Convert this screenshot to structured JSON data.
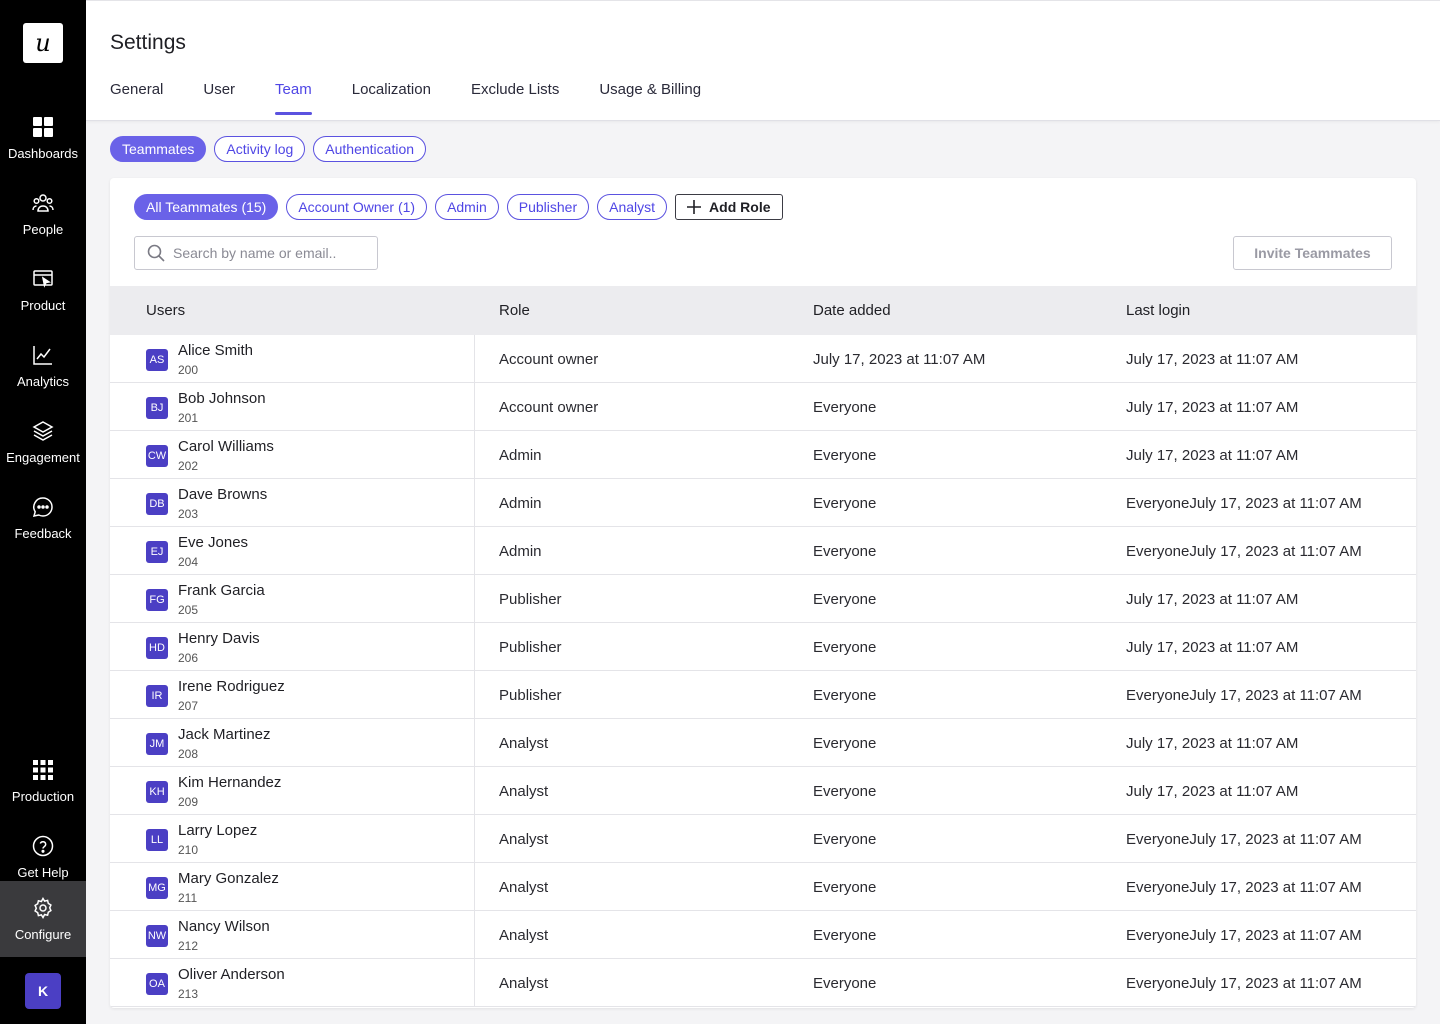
{
  "sidebar": {
    "logo": "u",
    "items": [
      {
        "label": "Dashboards",
        "icon": "dashboard-grid-icon"
      },
      {
        "label": "People",
        "icon": "people-icon"
      },
      {
        "label": "Product",
        "icon": "product-icon"
      },
      {
        "label": "Analytics",
        "icon": "analytics-chart-icon"
      },
      {
        "label": "Engagement",
        "icon": "layers-icon"
      },
      {
        "label": "Feedback",
        "icon": "chat-bubble-icon"
      }
    ],
    "bottom_items": [
      {
        "label": "Production",
        "icon": "apps-grid-icon"
      },
      {
        "label": "Get Help",
        "icon": "help-circle-icon"
      },
      {
        "label": "Configure",
        "icon": "gear-icon"
      }
    ],
    "user_avatar": "K"
  },
  "header": {
    "title": "Settings",
    "tabs": [
      "General",
      "User",
      "Team",
      "Localization",
      "Exclude Lists",
      "Usage & Billing"
    ],
    "active_tab": "Team"
  },
  "subtabs": [
    "Teammates",
    "Activity log",
    "Authentication"
  ],
  "roles": {
    "filters": [
      "All Teammates (15)",
      "Account Owner (1)",
      "Admin",
      "Publisher",
      "Analyst"
    ],
    "add_label": "Add Role"
  },
  "search": {
    "placeholder": "Search by name or email.."
  },
  "invite_label": "Invite Teammates",
  "table": {
    "headers": [
      "Users",
      "Role",
      "Date added",
      "Last login"
    ],
    "rows": [
      {
        "initials": "AS",
        "name": "Alice Smith",
        "id": "200",
        "role": "Account owner",
        "date": "July 17, 2023 at 11:07 AM",
        "login": "July 17, 2023 at 11:07 AM"
      },
      {
        "initials": "BJ",
        "name": "Bob Johnson",
        "id": "201",
        "role": "Account owner",
        "date": "Everyone",
        "login": "July 17, 2023 at 11:07 AM"
      },
      {
        "initials": "CW",
        "name": "Carol Williams",
        "id": "202",
        "role": "Admin",
        "date": "Everyone",
        "login": "July 17, 2023 at 11:07 AM"
      },
      {
        "initials": "DB",
        "name": "Dave Browns",
        "id": "203",
        "role": "Admin",
        "date": "Everyone",
        "login": "EveryoneJuly 17, 2023 at 11:07 AM"
      },
      {
        "initials": "EJ",
        "name": "Eve Jones",
        "id": "204",
        "role": "Admin",
        "date": "Everyone",
        "login": "EveryoneJuly 17, 2023 at 11:07 AM"
      },
      {
        "initials": "FG",
        "name": "Frank Garcia",
        "id": "205",
        "role": "Publisher",
        "date": "Everyone",
        "login": "July 17, 2023 at 11:07 AM"
      },
      {
        "initials": "HD",
        "name": "Henry Davis",
        "id": "206",
        "role": "Publisher",
        "date": "Everyone",
        "login": "July 17, 2023 at 11:07 AM"
      },
      {
        "initials": "IR",
        "name": "Irene Rodriguez",
        "id": "207",
        "role": "Publisher",
        "date": "Everyone",
        "login": "EveryoneJuly 17, 2023 at 11:07 AM"
      },
      {
        "initials": "JM",
        "name": "Jack Martinez",
        "id": "208",
        "role": "Analyst",
        "date": "Everyone",
        "login": "July 17, 2023 at 11:07 AM"
      },
      {
        "initials": "KH",
        "name": "Kim Hernandez",
        "id": "209",
        "role": "Analyst",
        "date": "Everyone",
        "login": "July 17, 2023 at 11:07 AM"
      },
      {
        "initials": "LL",
        "name": "Larry Lopez",
        "id": "210",
        "role": "Analyst",
        "date": "Everyone",
        "login": "EveryoneJuly 17, 2023 at 11:07 AM"
      },
      {
        "initials": "MG",
        "name": "Mary Gonzalez",
        "id": "211",
        "role": "Analyst",
        "date": "Everyone",
        "login": "EveryoneJuly 17, 2023 at 11:07 AM"
      },
      {
        "initials": "NW",
        "name": "Nancy Wilson",
        "id": "212",
        "role": "Analyst",
        "date": "Everyone",
        "login": "EveryoneJuly 17, 2023 at 11:07 AM"
      },
      {
        "initials": "OA",
        "name": "Oliver Anderson",
        "id": "213",
        "role": "Analyst",
        "date": "Everyone",
        "login": "EveryoneJuly 17, 2023 at 11:07 AM"
      }
    ]
  },
  "colors": {
    "accent": "#5b52e0",
    "avatar": "#4b3fc4",
    "sidebar": "#000000"
  }
}
